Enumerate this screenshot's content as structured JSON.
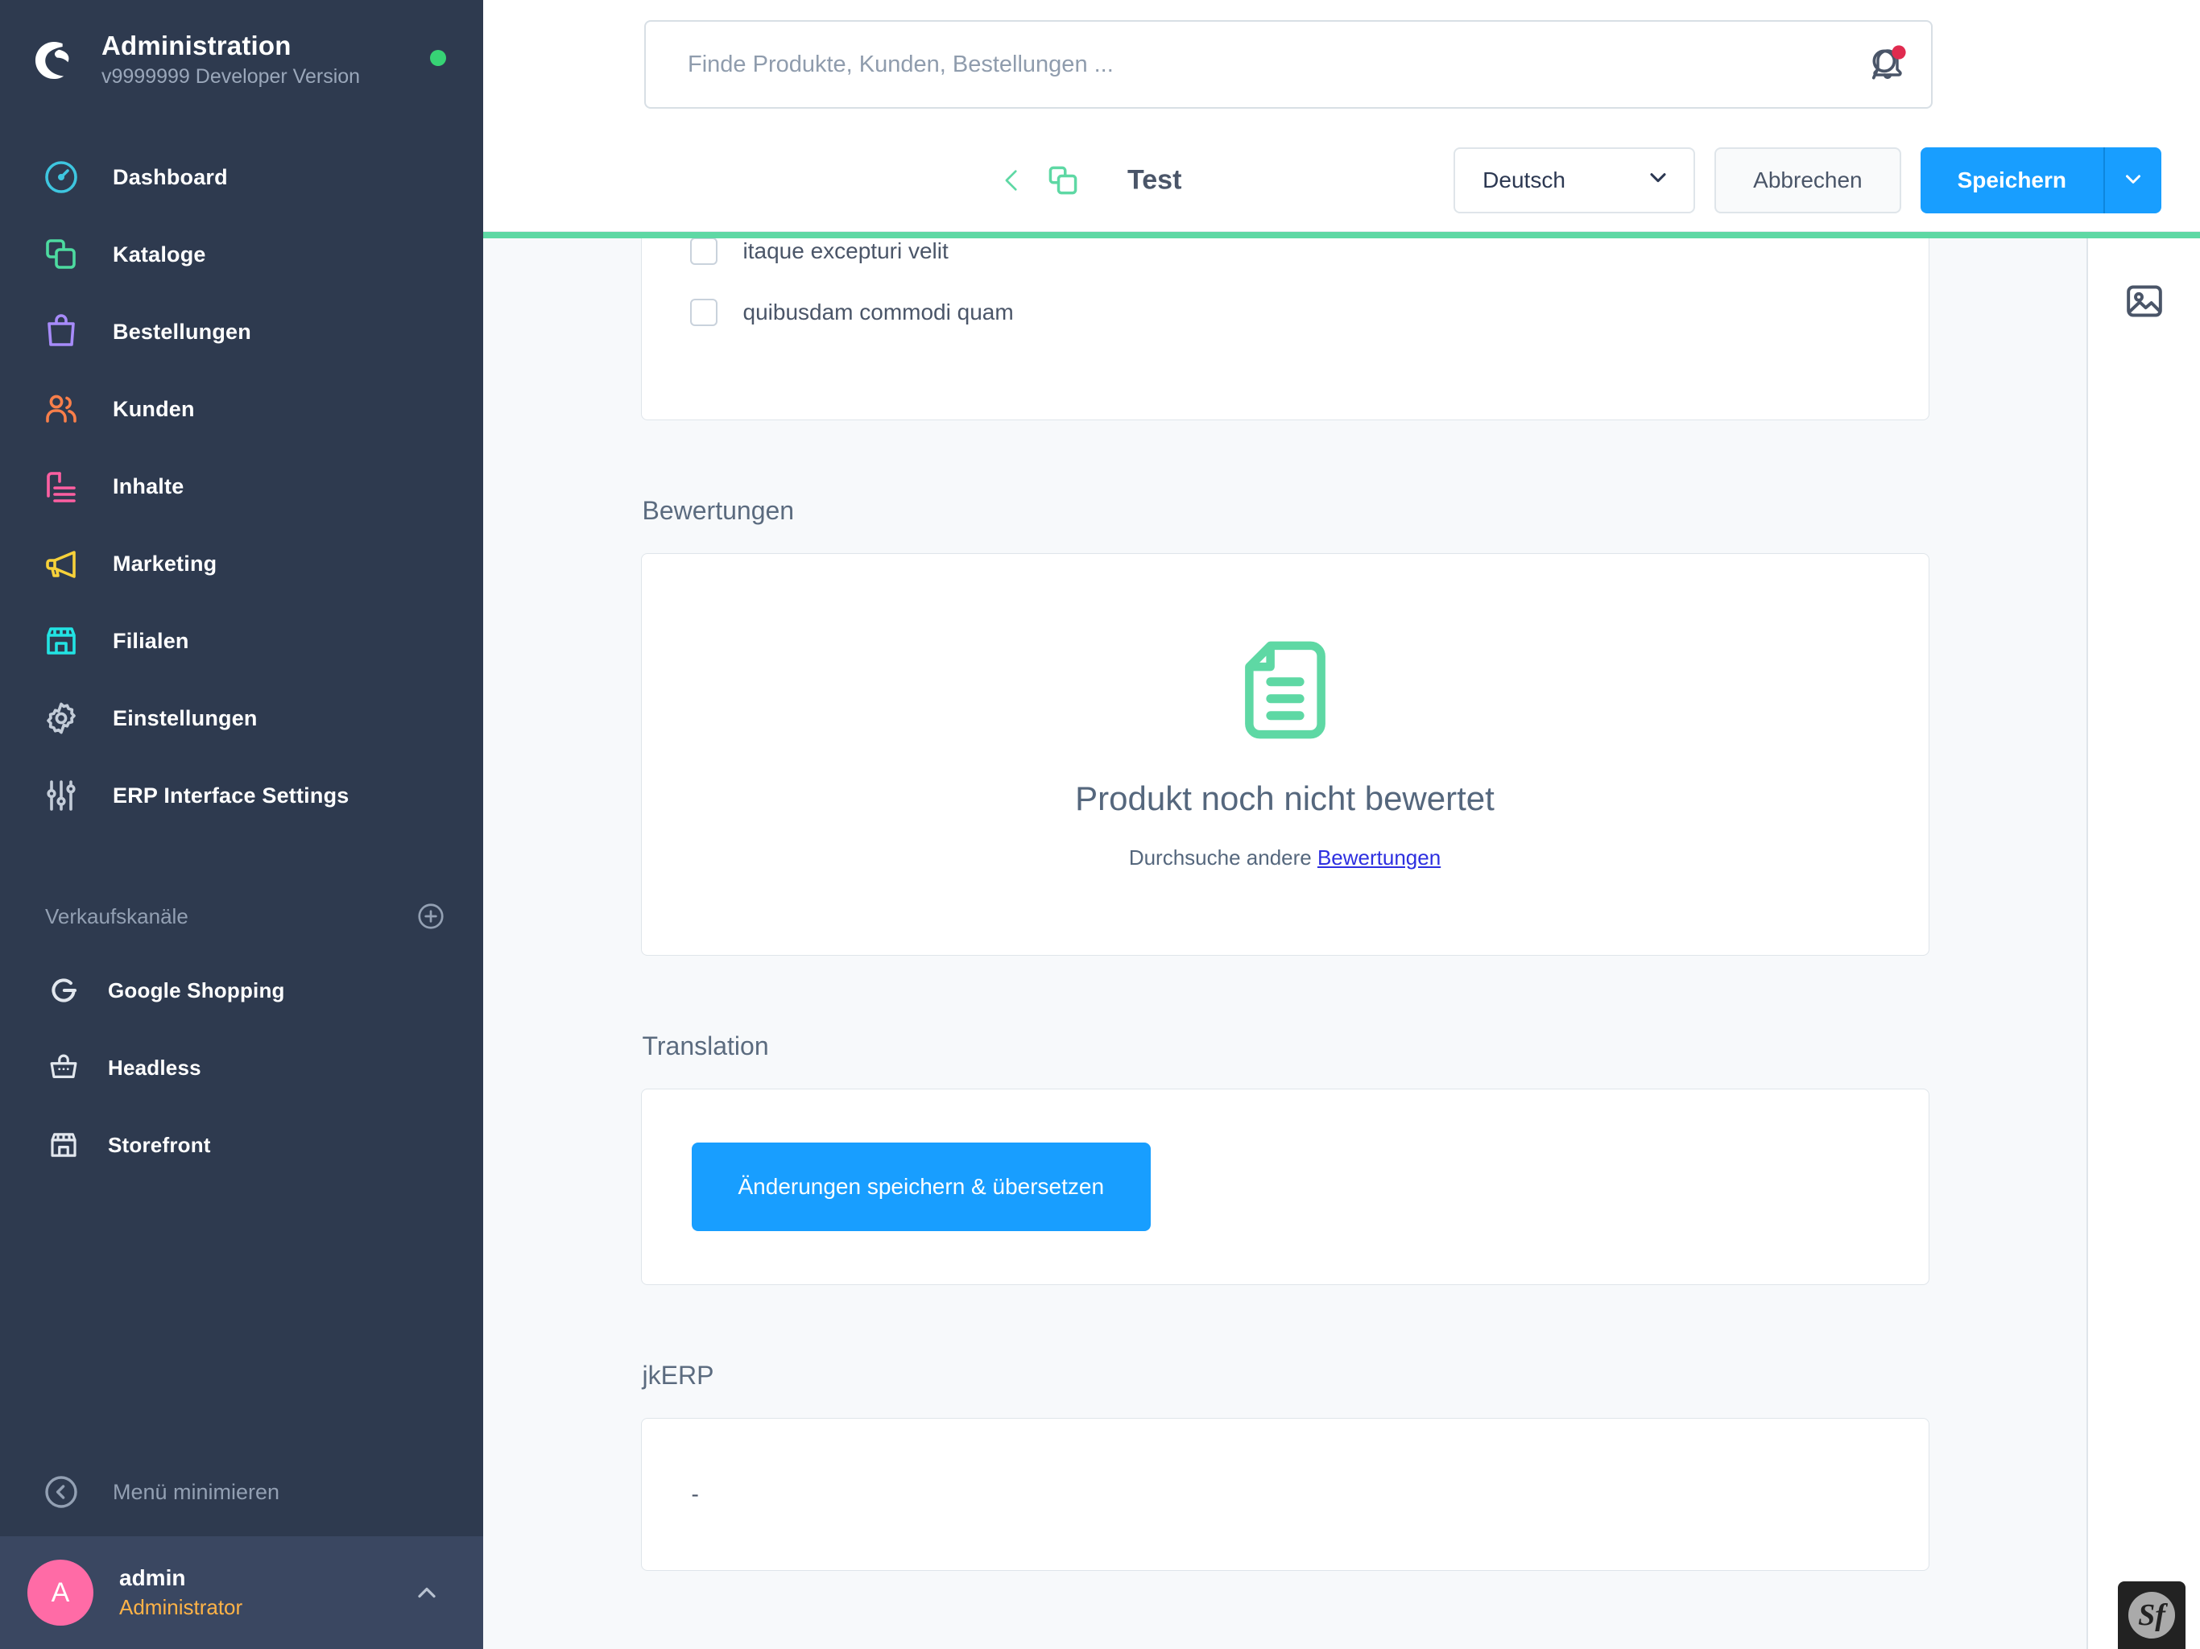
{
  "sidebar": {
    "brand": {
      "title": "Administration",
      "version": "v9999999 Developer Version",
      "status_color": "#37d375",
      "logo_icon": "shopware-logo-icon"
    },
    "items": [
      {
        "label": "Dashboard",
        "icon": "dashboard-gauge-icon",
        "color": "#3ec6e0"
      },
      {
        "label": "Kataloge",
        "icon": "catalog-copy-icon",
        "color": "#4ddba0"
      },
      {
        "label": "Bestellungen",
        "icon": "orders-bag-icon",
        "color": "#a78bfa"
      },
      {
        "label": "Kunden",
        "icon": "customers-users-icon",
        "color": "#f97f4a"
      },
      {
        "label": "Inhalte",
        "icon": "content-list-icon",
        "color": "#ff5fa2"
      },
      {
        "label": "Marketing",
        "icon": "marketing-megaphone-icon",
        "color": "#f7d13a"
      },
      {
        "label": "Filialen",
        "icon": "stores-shop-icon",
        "color": "#22e3e3"
      },
      {
        "label": "Einstellungen",
        "icon": "settings-gear-icon",
        "color": "#c3ccd8"
      },
      {
        "label": "ERP Interface Settings",
        "icon": "sliders-icon",
        "color": "#c3ccd8"
      }
    ],
    "sales_channels_section": {
      "title": "Verkaufskanäle",
      "add_icon": "plus-circle-icon"
    },
    "sales_channels": [
      {
        "label": "Google Shopping",
        "icon": "google-g-icon"
      },
      {
        "label": "Headless",
        "icon": "basket-icon"
      },
      {
        "label": "Storefront",
        "icon": "storefront-icon"
      }
    ],
    "minimize": {
      "label": "Menü minimieren",
      "icon": "chevron-left-circle-icon"
    },
    "user": {
      "initial": "A",
      "name": "admin",
      "role": "Administrator",
      "caret_icon": "chevron-up-icon",
      "avatar_color": "#ff6ba6"
    }
  },
  "topbar": {
    "search": {
      "placeholder": "Finde Produkte, Kunden, Bestellungen ...",
      "value": "",
      "icon": "search-icon"
    },
    "notifications": {
      "icon": "bell-icon",
      "has_unread": true,
      "badge_color": "#e02b4f"
    }
  },
  "smartbar": {
    "back_icon": "chevron-left-icon",
    "duplicate_icon": "duplicate-copy-icon",
    "title": "Test",
    "language": {
      "value": "Deutsch",
      "caret_icon": "chevron-down-icon"
    },
    "cancel_label": "Abbrechen",
    "save_label": "Speichern",
    "save_caret_icon": "chevron-down-icon",
    "accent_color": "#189eff"
  },
  "content": {
    "progress_color": "#5ed8a4",
    "properties_card": {
      "checkboxes": [
        {
          "label": "itaque excepturi velit",
          "checked": false
        },
        {
          "label": "quibusdam commodi quam",
          "checked": false
        }
      ]
    },
    "reviews": {
      "heading": "Bewertungen",
      "empty_icon": "document-lines-icon",
      "empty_icon_color": "#5ed8a4",
      "empty_title": "Produkt noch nicht bewertet",
      "empty_sub_prefix": "Durchsuche andere ",
      "empty_sub_link": "Bewertungen"
    },
    "translation": {
      "heading": "Translation",
      "button_label": "Änderungen speichern & übersetzen"
    },
    "jkerp": {
      "heading": "jkERP",
      "value": "-"
    }
  },
  "right_rail": {
    "media_icon": "image-media-icon"
  },
  "debug_toolbar": {
    "label": "Sf",
    "icon": "symfony-icon"
  }
}
